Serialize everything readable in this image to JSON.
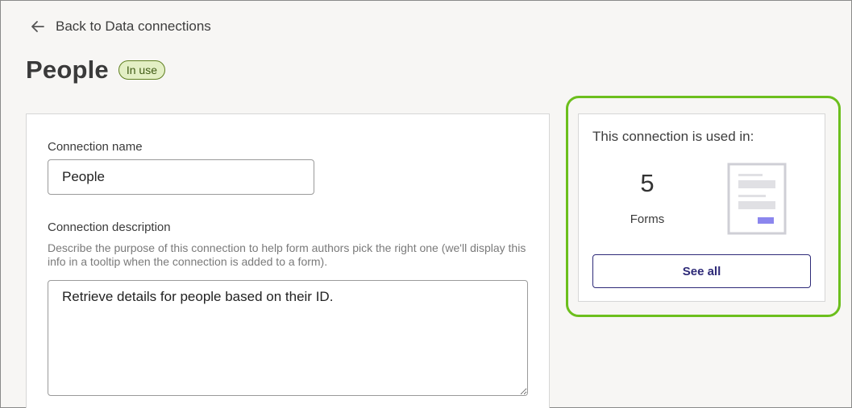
{
  "nav": {
    "back_label": "Back to Data connections"
  },
  "header": {
    "title": "People",
    "status_badge": "In use"
  },
  "form": {
    "name_label": "Connection name",
    "name_value": "People",
    "description_label": "Connection description",
    "description_help": "Describe the purpose of this connection to help form authors pick the right one (we'll display this info in a tooltip when the connection is added to a form).",
    "description_value": "Retrieve details for people based on their ID."
  },
  "usage": {
    "heading": "This connection is used in:",
    "count": "5",
    "type": "Forms",
    "see_all_label": "See all",
    "illustration_icon": "form-document-icon"
  },
  "colors": {
    "highlight": "#6cbf1d",
    "accent": "#2e2a78",
    "badge_bg": "#e3efc4",
    "illustration_accent": "#8b86ee"
  }
}
